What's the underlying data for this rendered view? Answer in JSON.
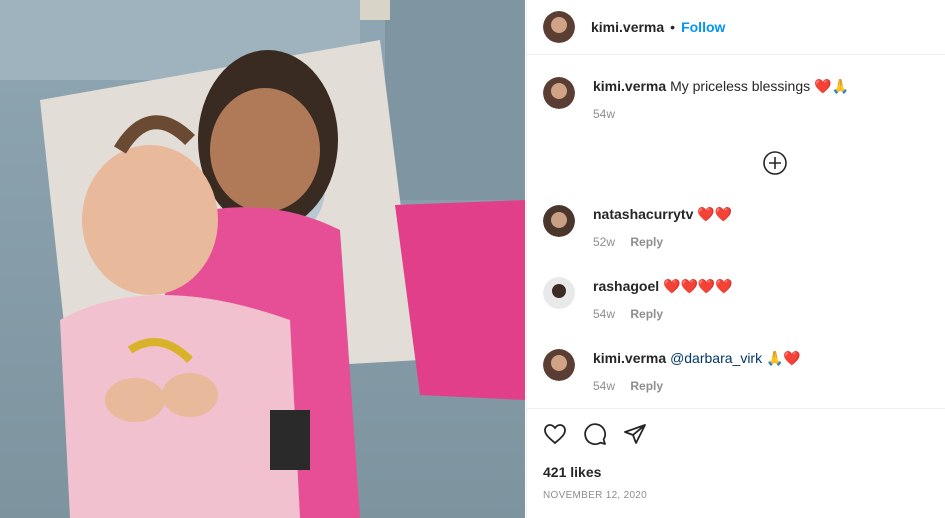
{
  "post": {
    "username": "kimi.verma",
    "follow_label": "Follow",
    "separator": "•",
    "caption_text": "My priceless blessings",
    "caption_emoji": "❤️🙏",
    "caption_time": "54w",
    "likes": "421 likes",
    "date": "NOVEMBER 12, 2020"
  },
  "comments": [
    {
      "username": "natashacurrytv",
      "text": "❤️❤️",
      "time": "52w",
      "reply": "Reply"
    },
    {
      "username": "rashagoel",
      "text": "❤️❤️❤️❤️",
      "time": "54w",
      "reply": "Reply"
    },
    {
      "username": "kimi.verma",
      "mention": "@darbara_virk",
      "text": "🙏❤️",
      "time": "54w",
      "reply": "Reply"
    }
  ],
  "icons": {
    "load_more": "plus-circle-icon",
    "like": "heart-icon",
    "comment": "comment-icon",
    "share": "share-icon"
  },
  "colors": {
    "accent": "#0095f6",
    "text": "#262626",
    "muted": "#8e8e8e"
  }
}
